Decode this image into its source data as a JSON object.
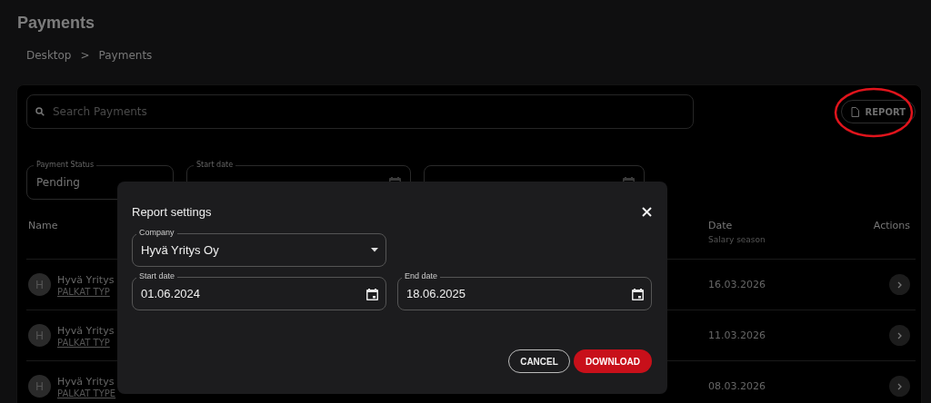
{
  "page": {
    "title": "Payments"
  },
  "breadcrumb": [
    {
      "label": "Desktop"
    },
    {
      "label": "Payments"
    }
  ],
  "breadcrumb_separator": ">",
  "search": {
    "placeholder": "Search Payments"
  },
  "report_button": {
    "label": "REPORT"
  },
  "filters": [
    {
      "label": "Payment Status",
      "value": "Pending",
      "kind": "select"
    },
    {
      "label": "Start date",
      "kind": "date"
    },
    {
      "kind": "date"
    }
  ],
  "table": {
    "columns": [
      {
        "label": "Name"
      },
      {
        "label": "Date",
        "sublabel": "Salary season"
      },
      {
        "label": "Actions"
      }
    ],
    "rows": [
      {
        "avatar": "H",
        "name": "Hyvä Yritys",
        "link": "PALKAT TYP",
        "date": "16.03.2026"
      },
      {
        "avatar": "H",
        "name": "Hyvä Yritys",
        "link": "PALKAT TYP",
        "date": "11.03.2026"
      },
      {
        "avatar": "H",
        "name": "Hyvä Yritys",
        "link": "PALKAT TYPE",
        "date": "08.03.2026"
      }
    ]
  },
  "dialog": {
    "title": "Report settings",
    "fields": [
      {
        "label": "Company",
        "value": "Hyvä Yritys Oy",
        "kind": "select"
      },
      {
        "label": "Start date",
        "value": "01.06.2024",
        "kind": "date"
      },
      {
        "label": "End date",
        "value": "18.06.2025",
        "kind": "date"
      }
    ],
    "buttons": [
      {
        "label": "CANCEL",
        "kind": "outlined"
      },
      {
        "label": "DOWNLOAD",
        "kind": "primary"
      }
    ]
  }
}
